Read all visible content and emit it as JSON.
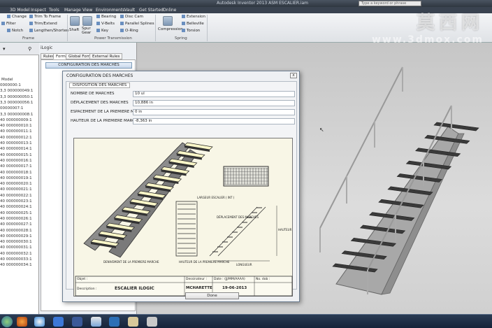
{
  "window": {
    "title": "Autodesk Inventor 2013   ASM ESCALIER.iam",
    "search_placeholder": "Type a keyword or phrase"
  },
  "menu": [
    "3D Model",
    "Inspect",
    "Tools",
    "Manage",
    "View",
    "Environments",
    "Vault",
    "Get Started",
    "Online"
  ],
  "ribbon": {
    "frame_items": [
      "Change",
      "Filter",
      "Notch"
    ],
    "frame_items2": [
      "Trim To Frame",
      "Trim/Extend",
      "Lengthen/Shorten"
    ],
    "frame_label": "Frame",
    "pt_big": [
      "Shaft",
      "Spur Gear"
    ],
    "pt_items": [
      "Bearing",
      "V-Belts",
      "Key"
    ],
    "pt_items2": [
      "Disc Cam",
      "Parallel Splines",
      "O-Ring"
    ],
    "pt_label": "Power Transmission",
    "spring_big": "Compression",
    "spring_items": [
      "Extension",
      "Belleville",
      "Torsion"
    ],
    "spring_label": "Spring"
  },
  "browser": {
    "model_label": "Model",
    "rows": [
      "0000000:1",
      "3,3 000000049:1",
      "3,3 000000050:1",
      "3,3 000000056:1",
      "00000007:1",
      "3,3 000000008:1",
      "40 000000009:1",
      "40 000000010:1",
      "40 000000011:1",
      "40 000000012:1",
      "40 000000013:1",
      "40 000000014:1",
      "40 000000015:1",
      "40 000000016:1",
      "40 000000017:1",
      "40 000000018:1",
      "40 000000019:1",
      "40 000000020:1",
      "40 000000021:1",
      "40 000000022:1",
      "40 000000023:1",
      "40 000000024:1",
      "40 000000025:1",
      "40 000000026:1",
      "40 000000027:1",
      "40 000000028:1",
      "40 000000029:1",
      "40 000000030:1",
      "40 000000031:1",
      "40 000000032:1",
      "40 000000033:1",
      "40 000000034:1"
    ]
  },
  "ilogic": {
    "title": "iLogic",
    "tabs": [
      "Rules",
      "Forms",
      "Global Forms",
      "External Rules"
    ],
    "config_button": "CONFIGURATION DES MARCHES"
  },
  "dialog": {
    "title": "CONFIGURATION DES MARCHES",
    "close": "x",
    "group_tab": "DISPOSITION DES MARCHES",
    "fields": [
      {
        "label": "NOMBRE DE MARCHES",
        "value": "10 ul"
      },
      {
        "label": "DÉPLACEMENT DES MARCHES",
        "value": "10,886 in"
      },
      {
        "label": "ESPACEMENT DE LA PREMIERE MARCHE",
        "value": "0 in"
      },
      {
        "label": "HAUTEUR DE LA PREMIERE MARCHE",
        "value": "-8,363 in"
      }
    ],
    "done": "Done"
  },
  "drawing": {
    "label_first_step": "DENIVEMENT DE LA PREMIERE MARCHE",
    "label_length": "LARGEUR ESCALIER ( INT )",
    "label_disp": "DÉPLACEMENT DES MARCHES",
    "label_height": "HAUTEUR",
    "label_long": "LONGUEUR",
    "label_first_h": "HAUTEUR DE LA PREMIERE MARCHE",
    "tb_object": "Objet :",
    "tb_designer": "Dessinateur :",
    "tb_date": "Date : (JJ/MM/AAAA)",
    "tb_no": "No. dob :",
    "tb_desc_label": "Description :",
    "tb_desc": "ESCALIER ILOGIC",
    "tb_designer_val": "MCHARETTE",
    "tb_date_val": "19-06-2013"
  },
  "watermark": {
    "cn": "莫西网",
    "url": "www.3dmox.com"
  },
  "colors": {
    "accent": "#6a8fbf",
    "titlebar": "#3a4350",
    "taskbar": "#1c2a40"
  }
}
